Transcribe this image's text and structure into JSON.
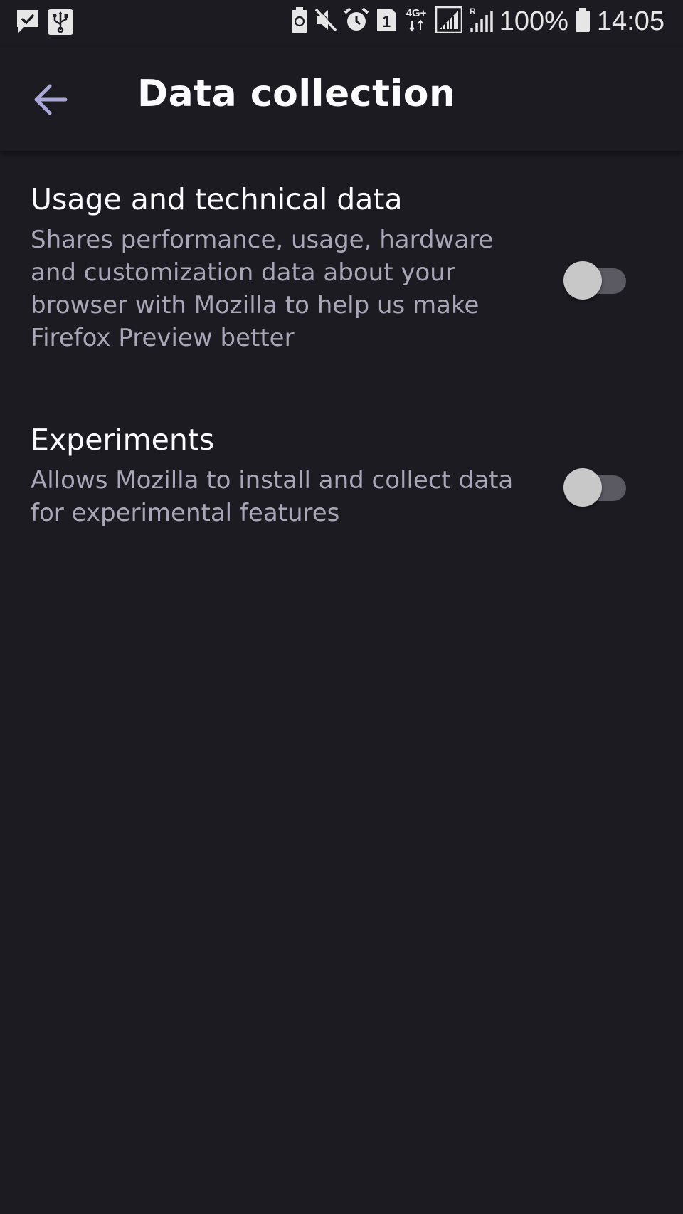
{
  "status_bar": {
    "left_icons": [
      "message-check-icon",
      "usb-icon"
    ],
    "right_icons": [
      "battery-saver-icon",
      "mute-icon",
      "alarm-icon",
      "sim-1-icon",
      "network-4g-icon",
      "signal-icon",
      "roaming-signal-icon"
    ],
    "network_label": "4G+",
    "sim_label": "1",
    "battery_percent": "100%",
    "time": "14:05"
  },
  "app_bar": {
    "back_icon": "arrow-back-icon",
    "title": "Data collection"
  },
  "preferences": [
    {
      "title": "Usage and technical data",
      "summary": "Shares performance, usage, hardware and customization data about your browser with Mozilla to help us make Firefox Preview better",
      "enabled": false
    },
    {
      "title": "Experiments",
      "summary": "Allows Mozilla to install and collect data for experimental features",
      "enabled": false
    }
  ],
  "colors": {
    "background": "#1c1b22",
    "title_text": "#fbfbfe",
    "summary_text": "#a9a6b8",
    "switch_track_off": "#5b5a63",
    "switch_thumb_off": "#c8c8c8"
  }
}
